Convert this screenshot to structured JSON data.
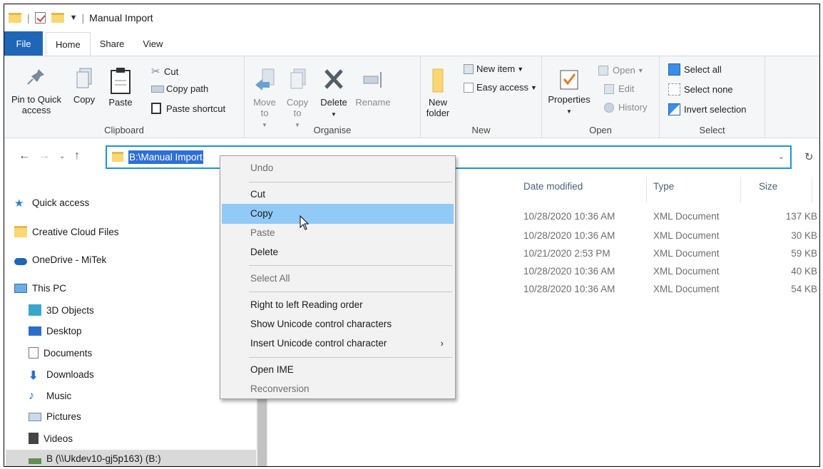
{
  "window": {
    "title": "Manual Import"
  },
  "tabs": [
    {
      "label": "File"
    },
    {
      "label": "Home"
    },
    {
      "label": "Share"
    },
    {
      "label": "View"
    }
  ],
  "ribbon": {
    "clipboard": {
      "label": "Clipboard",
      "pin_label": "Pin to Quick access",
      "copy_label": "Copy",
      "paste_label": "Paste",
      "cut_label": "Cut",
      "copy_path_label": "Copy path",
      "paste_shortcut_label": "Paste shortcut"
    },
    "organise": {
      "label": "Organise",
      "move_to_label": "Move to",
      "copy_to_label": "Copy to",
      "delete_label": "Delete",
      "rename_label": "Rename"
    },
    "new": {
      "label": "New",
      "new_folder_label": "New folder",
      "new_item_label": "New item",
      "easy_access_label": "Easy access"
    },
    "open": {
      "label": "Open",
      "properties_label": "Properties",
      "open_label": "Open",
      "edit_label": "Edit",
      "history_label": "History"
    },
    "select": {
      "label": "Select",
      "select_all_label": "Select all",
      "select_none_label": "Select none",
      "invert_label": "Invert selection"
    }
  },
  "address": {
    "value": "B:\\Manual Import"
  },
  "nav_pane": {
    "items": [
      {
        "label": "Quick access"
      },
      {
        "label": "Creative Cloud Files"
      },
      {
        "label": "OneDrive - MiTek"
      },
      {
        "label": "This PC"
      },
      {
        "label": "3D Objects"
      },
      {
        "label": "Desktop"
      },
      {
        "label": "Documents"
      },
      {
        "label": "Downloads"
      },
      {
        "label": "Music"
      },
      {
        "label": "Pictures"
      },
      {
        "label": "Videos"
      },
      {
        "label": "B (\\\\Ukdev10-gj5p163) (B:)"
      }
    ]
  },
  "file_list": {
    "columns": {
      "date": "Date modified",
      "type": "Type",
      "size": "Size"
    },
    "rows": [
      {
        "date": "10/28/2020 10:36 AM",
        "type": "XML Document",
        "size": "137 KB"
      },
      {
        "date": "10/28/2020 10:36 AM",
        "type": "XML Document",
        "size": "30 KB"
      },
      {
        "date": "10/21/2020 2:53 PM",
        "type": "XML Document",
        "size": "59 KB"
      },
      {
        "date": "10/28/2020 10:36 AM",
        "type": "XML Document",
        "size": "40 KB"
      },
      {
        "date": "10/28/2020 10:36 AM",
        "type": "XML Document",
        "size": "54 KB"
      }
    ]
  },
  "context_menu": {
    "items": [
      {
        "label": "Undo"
      },
      {
        "label": "Cut"
      },
      {
        "label": "Copy"
      },
      {
        "label": "Paste"
      },
      {
        "label": "Delete"
      },
      {
        "label": "Select All"
      },
      {
        "label": "Right to left Reading order"
      },
      {
        "label": "Show Unicode control characters"
      },
      {
        "label": "Insert Unicode control character"
      },
      {
        "label": "Open IME"
      },
      {
        "label": "Reconversion"
      }
    ]
  },
  "colors": {
    "accent": "#1f66b7",
    "address_border": "#1a94d4",
    "menu_highlight": "#91c9f7",
    "selection": "#2f6fd6"
  }
}
